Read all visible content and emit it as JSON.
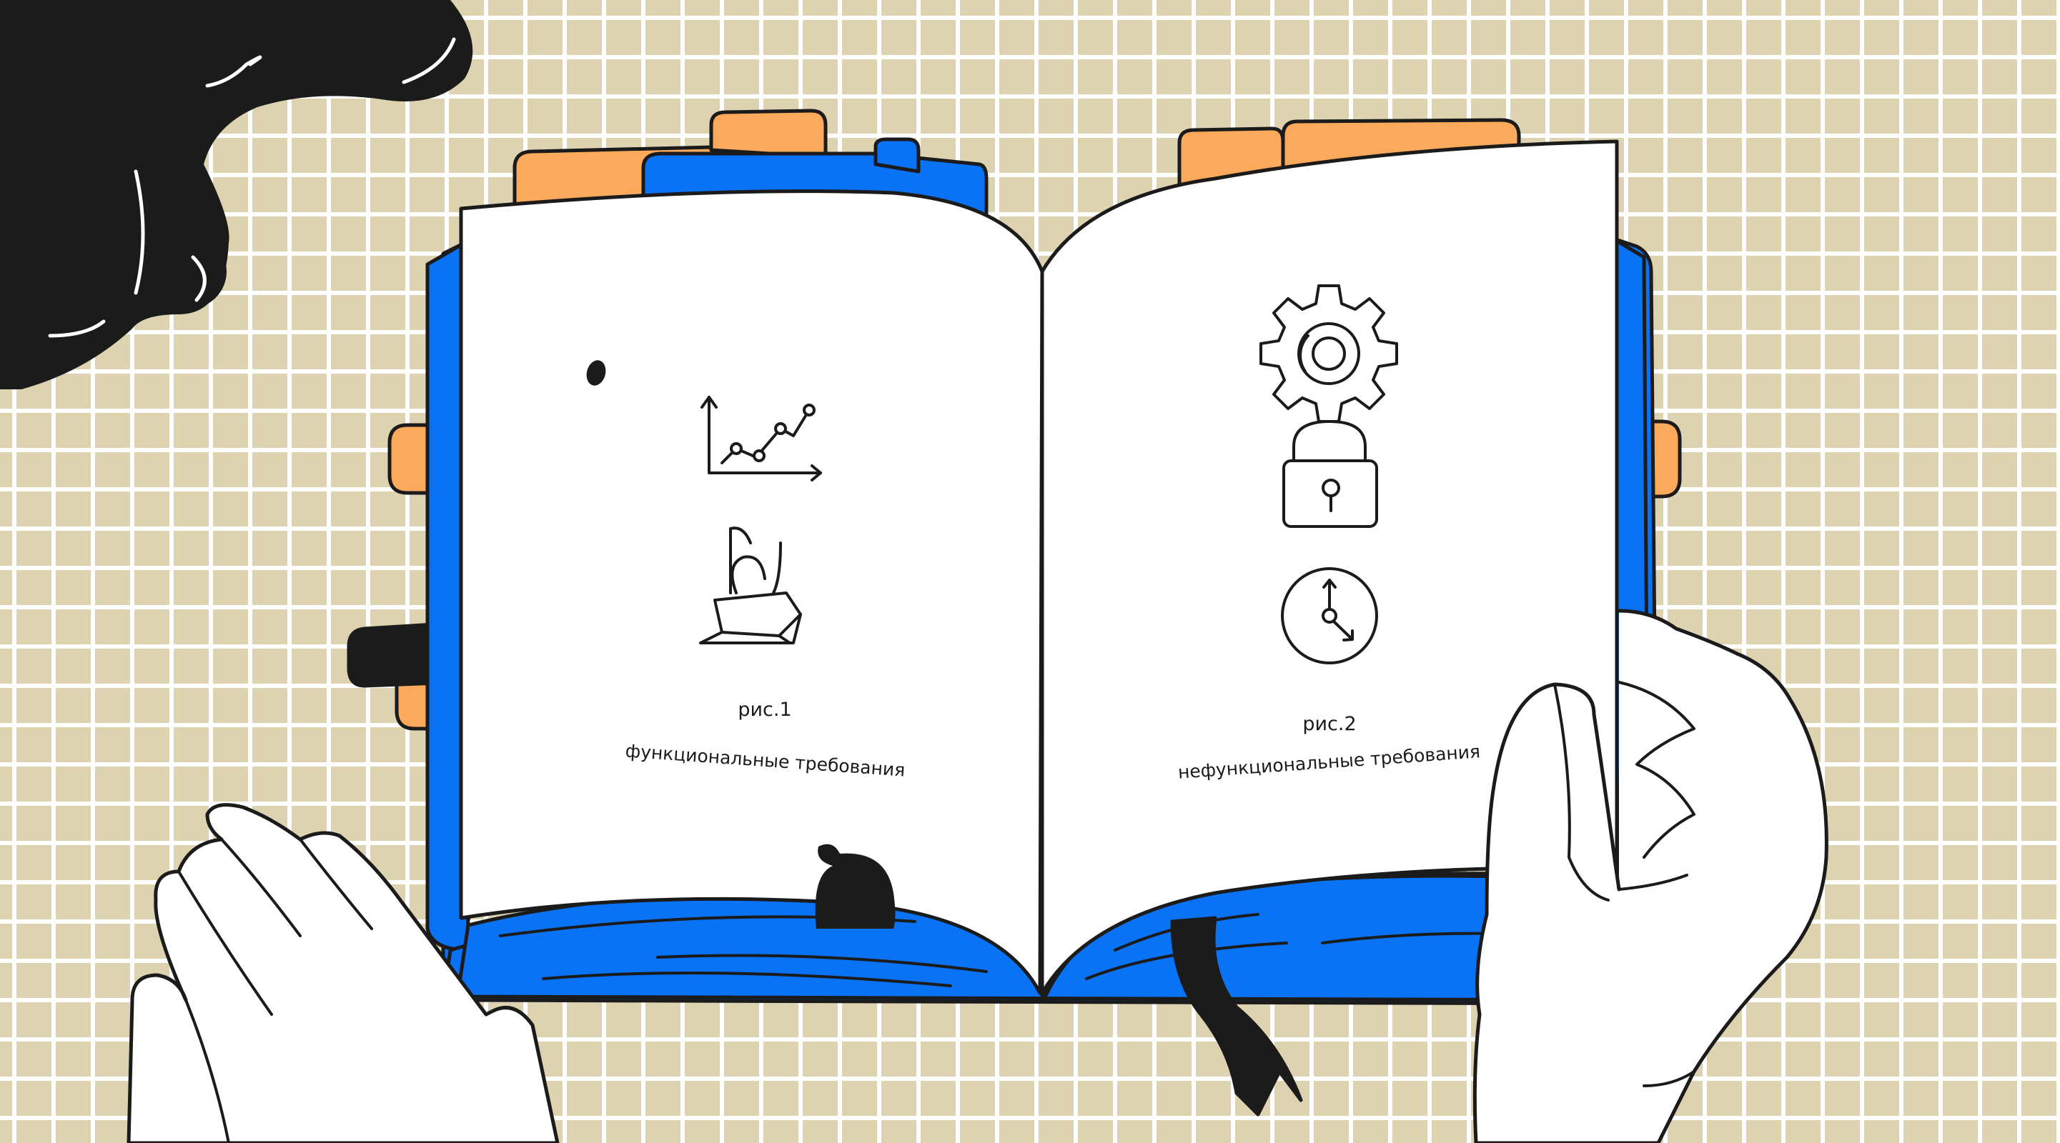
{
  "illustration": {
    "left_page": {
      "figure_label": "рис.1",
      "caption": "функциональные требования",
      "icons": [
        "line-chart-icon",
        "finger-pressing-button-icon"
      ]
    },
    "right_page": {
      "figure_label": "рис.2",
      "caption": "нефункциональные требования",
      "icons": [
        "gear-icon",
        "padlock-icon",
        "clock-icon"
      ]
    },
    "colors": {
      "background": "#ddd3b0",
      "grid_lines": "#ffffff",
      "book_cover": "#0a72f5",
      "tabs": "#fbaa5b",
      "outline": "#1b1b1b",
      "page": "#ffffff"
    }
  }
}
